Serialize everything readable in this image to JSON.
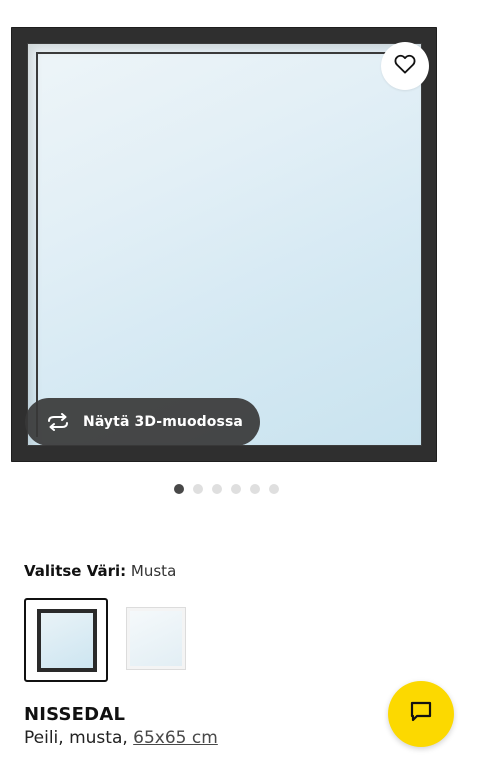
{
  "product_image": {
    "favourite_icon": "heart-outline-icon",
    "view_3d": {
      "label": "Näytä 3D-muodossa",
      "icon": "rotate-3d-icon"
    }
  },
  "carousel": {
    "total": 6,
    "active_index": 0
  },
  "colour": {
    "label": "Valitse Väri:",
    "value": "Musta",
    "options": [
      {
        "name": "musta",
        "selected": true
      },
      {
        "name": "valkoinen",
        "selected": false
      }
    ]
  },
  "product": {
    "name": "NISSEDAL",
    "description": "Peili, musta,",
    "size": "65x65 cm"
  },
  "chat": {
    "icon": "chat-bubble-icon",
    "color": "#fcd900"
  },
  "colors": {
    "frame": "#2f2f2f",
    "accent": "#fcd900",
    "text": "#111111"
  }
}
